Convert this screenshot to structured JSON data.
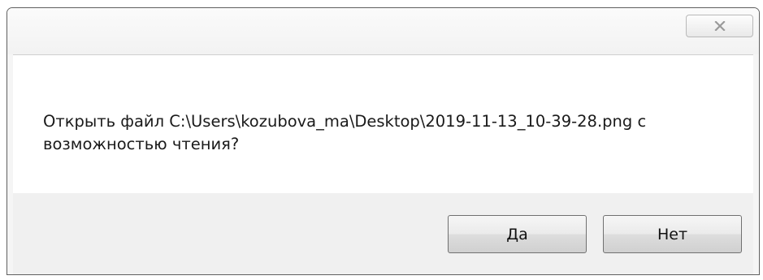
{
  "dialog": {
    "close_icon": "close-icon",
    "message": "Открыть файл C:\\Users\\kozubova_ma\\Desktop\\2019-11-13_10-39-28.png с возможностью чтения?",
    "buttons": {
      "yes_label": "Да",
      "no_label": "Нет"
    }
  }
}
